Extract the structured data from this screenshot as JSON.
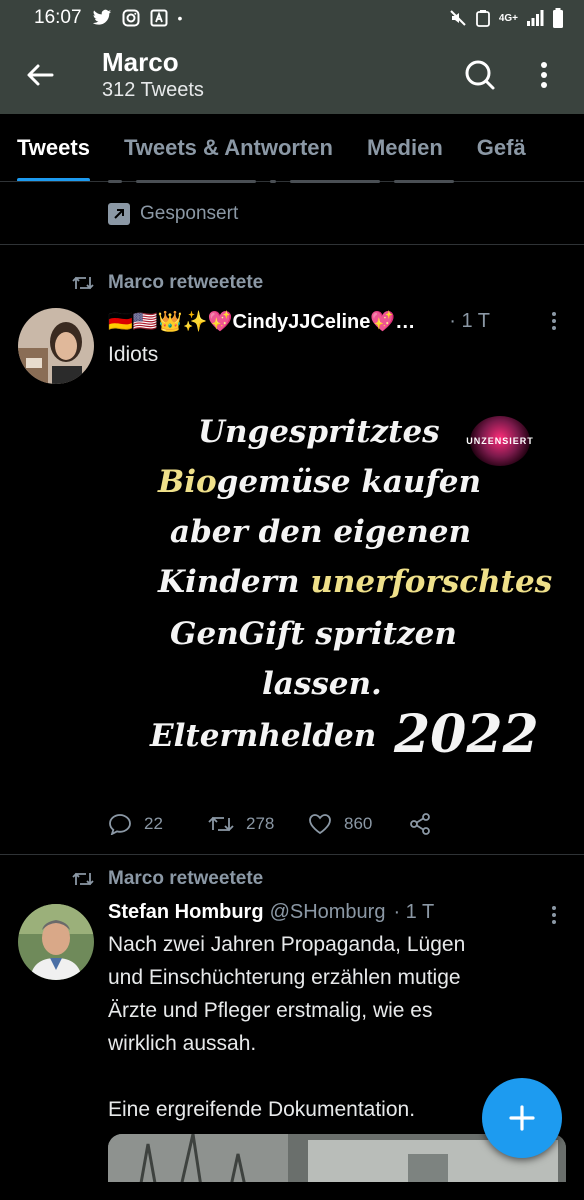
{
  "status_bar": {
    "time": "16:07",
    "network": "4G+"
  },
  "header": {
    "title": "Marco",
    "subtitle": "312 Tweets"
  },
  "tabs": [
    {
      "label": "Tweets",
      "active": true
    },
    {
      "label": "Tweets & Antworten",
      "active": false
    },
    {
      "label": "Medien",
      "active": false
    },
    {
      "label": "Gefä",
      "active": false
    }
  ],
  "sponsored_label": "Gesponsert",
  "tweets": [
    {
      "retweet_label": "Marco retweetete",
      "author_name": "🇩🇪🇺🇸👑✨💖CindyJJCeline💖…",
      "time": "· 1 T",
      "text": "Idiots",
      "media_lines": {
        "l1": "Ungespritztes",
        "l2a": "Bio",
        "l2b": "gemüse kaufen",
        "l3": "aber den eigenen",
        "l4a": "Kindern ",
        "l4b": "unerforschtes",
        "l5": "GenGift  spritzen",
        "l6": "lassen.",
        "l7a": "Elternhelden",
        "l7b": "2022",
        "badge": "UNZENSIERT"
      },
      "replies": "22",
      "retweets": "278",
      "likes": "860"
    },
    {
      "retweet_label": "Marco retweetete",
      "author_name": "Stefan Homburg",
      "handle": "@SHomburg",
      "time": "· 1 T",
      "text": "Nach zwei Jahren Propaganda, Lügen\nund Einschüchterung erzählen mutige\nÄrzte und Pfleger erstmalig, wie es\nwirklich aussah.\n\nEine ergreifende Dokumentation."
    }
  ],
  "colors": {
    "header_bg": "#3a433e",
    "accent": "#1d9bf0",
    "muted": "#8b98a5"
  },
  "icons": [
    "twitter-icon",
    "instagram-icon",
    "arrow-back-icon",
    "search-icon",
    "more-vertical-icon",
    "retweet-icon",
    "reply-icon",
    "like-icon",
    "share-icon",
    "plus-icon"
  ]
}
